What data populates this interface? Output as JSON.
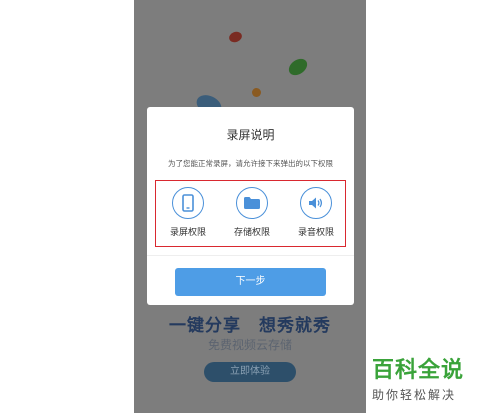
{
  "promo": {
    "title": "一键分享　想秀就秀",
    "subtitle": "免费视频云存储",
    "button_label": "立即体验"
  },
  "dialog": {
    "title": "录屏说明",
    "description": "为了您能正常录屏，请允许接下来弹出的以下权限",
    "permissions": [
      {
        "label": "录屏权限",
        "icon": "phone-icon"
      },
      {
        "label": "存储权限",
        "icon": "folder-icon"
      },
      {
        "label": "录音权限",
        "icon": "speaker-icon"
      }
    ],
    "next_label": "下一步"
  },
  "watermark": {
    "main": "百科全说",
    "sub": "助你轻松解决"
  },
  "colors": {
    "accent": "#4e9de6",
    "highlight_border": "#d9282f",
    "watermark_green": "#3aa33a"
  }
}
